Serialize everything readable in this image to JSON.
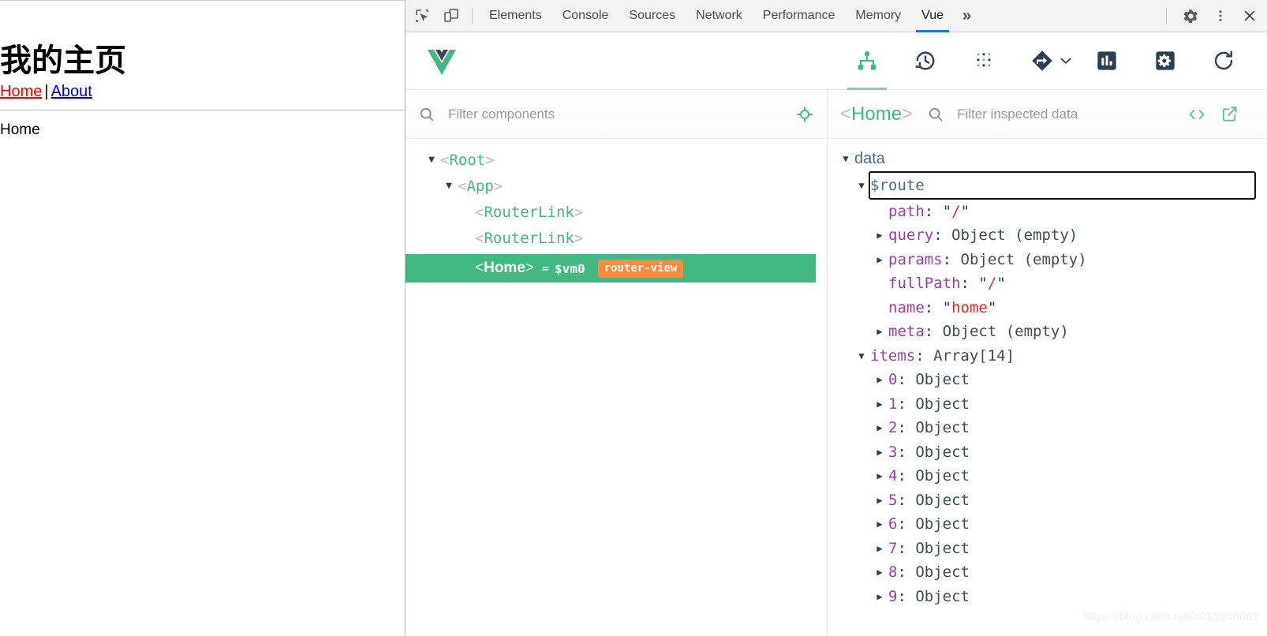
{
  "webpage": {
    "title": "我的主页",
    "nav": {
      "home": "Home",
      "separator": "|",
      "about": "About"
    },
    "content": "Home"
  },
  "devtools": {
    "left_icons": [
      {
        "name": "inspect-element-icon"
      },
      {
        "name": "device-toolbar-icon"
      }
    ],
    "tabs": [
      {
        "label": "Elements",
        "active": false
      },
      {
        "label": "Console",
        "active": false
      },
      {
        "label": "Sources",
        "active": false
      },
      {
        "label": "Network",
        "active": false
      },
      {
        "label": "Performance",
        "active": false
      },
      {
        "label": "Memory",
        "active": false
      },
      {
        "label": "Vue",
        "active": true
      }
    ],
    "more_label": "»",
    "right_icons": [
      {
        "name": "settings-gear-icon"
      },
      {
        "name": "more-vertical-icon"
      },
      {
        "name": "close-icon"
      }
    ],
    "active_tab_underline_color": "#1a73e8"
  },
  "vue_toolbar": {
    "logo": "vue-logo",
    "logo_colors": {
      "green": "#42b883",
      "dark": "#35495e"
    },
    "tabs": [
      {
        "name": "components-tab",
        "icon": "component-tree-icon",
        "active": true
      },
      {
        "name": "timeline-tab",
        "icon": "history-clock-icon",
        "active": false
      },
      {
        "name": "vuex-tab",
        "icon": "vuex-dots-icon",
        "active": false
      },
      {
        "name": "routing-tab",
        "icon": "router-diamond-icon",
        "active": false,
        "has_caret": true
      },
      {
        "name": "performance-tab",
        "icon": "bar-chart-icon",
        "active": false
      },
      {
        "name": "settings-tab",
        "icon": "gear-square-icon",
        "active": false
      },
      {
        "name": "refresh-button",
        "icon": "refresh-icon",
        "active": false
      }
    ],
    "accent_color": "#42b983"
  },
  "components_pane": {
    "search": {
      "placeholder": "Filter components",
      "value": ""
    },
    "select_icon": "target-crosshair-icon",
    "tree": [
      {
        "label": "Root",
        "depth": 0,
        "expanded": true,
        "has_arrow": true,
        "selected": false
      },
      {
        "label": "App",
        "depth": 1,
        "expanded": true,
        "has_arrow": true,
        "selected": false
      },
      {
        "label": "RouterLink",
        "depth": 2,
        "expanded": false,
        "has_arrow": false,
        "selected": false
      },
      {
        "label": "RouterLink",
        "depth": 2,
        "expanded": false,
        "has_arrow": false,
        "selected": false
      },
      {
        "label": "Home",
        "depth": 2,
        "expanded": false,
        "has_arrow": false,
        "selected": true,
        "vm": "$vm0",
        "eq": "=",
        "badge": "router-view"
      }
    ]
  },
  "inspector_pane": {
    "component_name": "Home",
    "search": {
      "placeholder": "Filter inspected data",
      "value": ""
    },
    "tools": [
      {
        "name": "open-in-editor-icon",
        "glyph": "<>"
      },
      {
        "name": "external-link-icon"
      }
    ],
    "sections": [
      {
        "label": "data",
        "expanded": true,
        "rows": [
          {
            "key": "$route",
            "depth": 1,
            "caret": "expanded",
            "key_color": "blue",
            "highlighted": true
          },
          {
            "key": "path",
            "depth": 2,
            "caret": "none",
            "value": "\"/\"",
            "value_type": "string",
            "value_inner": "/"
          },
          {
            "key": "query",
            "depth": 2,
            "caret": "collapsed",
            "value": "Object (empty)",
            "value_type": "object"
          },
          {
            "key": "params",
            "depth": 2,
            "caret": "collapsed",
            "value": "Object (empty)",
            "value_type": "object"
          },
          {
            "key": "fullPath",
            "depth": 2,
            "caret": "none",
            "value": "\"/\"",
            "value_type": "string",
            "value_inner": "/"
          },
          {
            "key": "name",
            "depth": 2,
            "caret": "none",
            "value": "\"home\"",
            "value_type": "string",
            "value_inner": "home"
          },
          {
            "key": "meta",
            "depth": 2,
            "caret": "collapsed",
            "value": "Object (empty)",
            "value_type": "object"
          },
          {
            "key": "items",
            "depth": 1,
            "caret": "expanded",
            "value": "Array[14]",
            "value_type": "array"
          },
          {
            "key": "0",
            "depth": 2,
            "caret": "collapsed",
            "value": "Object",
            "value_type": "object"
          },
          {
            "key": "1",
            "depth": 2,
            "caret": "collapsed",
            "value": "Object",
            "value_type": "object"
          },
          {
            "key": "2",
            "depth": 2,
            "caret": "collapsed",
            "value": "Object",
            "value_type": "object"
          },
          {
            "key": "3",
            "depth": 2,
            "caret": "collapsed",
            "value": "Object",
            "value_type": "object"
          },
          {
            "key": "4",
            "depth": 2,
            "caret": "collapsed",
            "value": "Object",
            "value_type": "object"
          },
          {
            "key": "5",
            "depth": 2,
            "caret": "collapsed",
            "value": "Object",
            "value_type": "object"
          },
          {
            "key": "6",
            "depth": 2,
            "caret": "collapsed",
            "value": "Object",
            "value_type": "object"
          },
          {
            "key": "7",
            "depth": 2,
            "caret": "collapsed",
            "value": "Object",
            "value_type": "object"
          },
          {
            "key": "8",
            "depth": 2,
            "caret": "collapsed",
            "value": "Object",
            "value_type": "object"
          },
          {
            "key": "9",
            "depth": 2,
            "caret": "collapsed",
            "value": "Object",
            "value_type": "object"
          }
        ]
      }
    ]
  },
  "watermark": "https://blog.csdn.net/u013946061"
}
